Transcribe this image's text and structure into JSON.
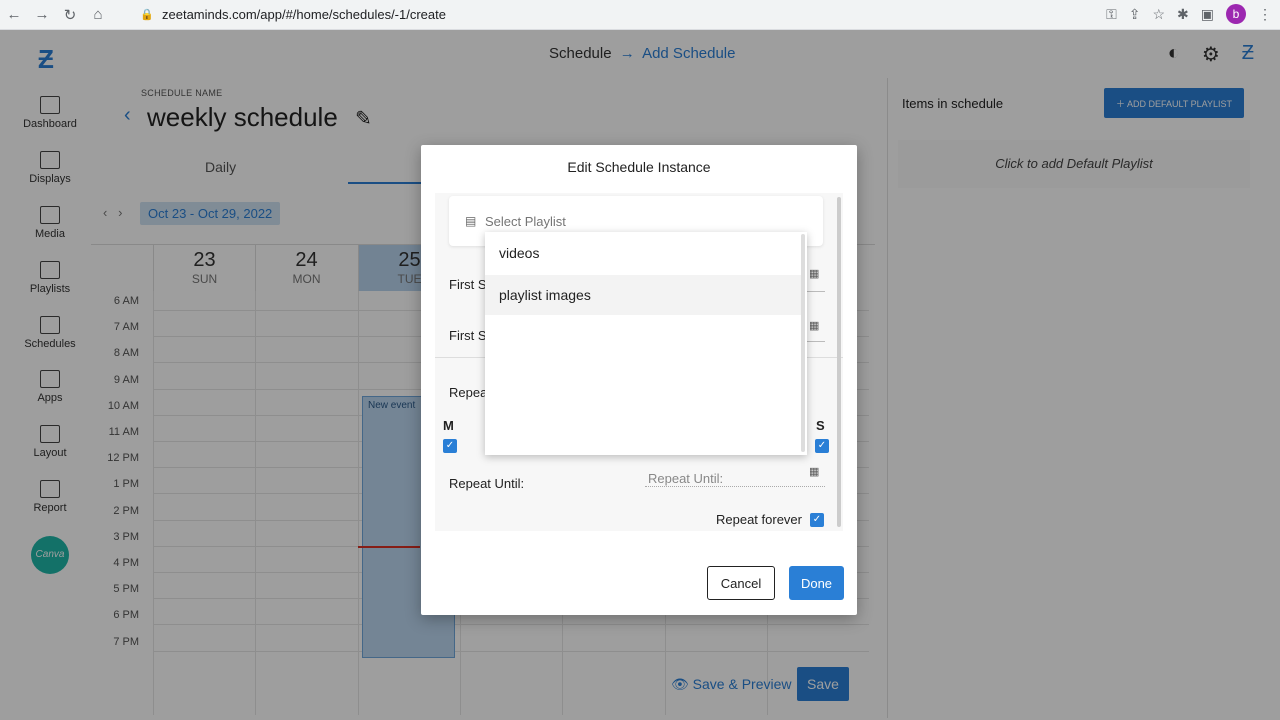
{
  "browser": {
    "url": "zeetaminds.com/app/#/home/schedules/-1/create",
    "avatar_letter": "b"
  },
  "header": {
    "crumb_parent": "Schedule",
    "crumb_current": "Add Schedule"
  },
  "sidebar": {
    "items": [
      {
        "label": "Dashboard",
        "icon": "dashboard-icon"
      },
      {
        "label": "Displays",
        "icon": "monitor-icon"
      },
      {
        "label": "Media",
        "icon": "image-icon"
      },
      {
        "label": "Playlists",
        "icon": "playlist-icon"
      },
      {
        "label": "Schedules",
        "icon": "calendar-icon"
      },
      {
        "label": "Apps",
        "icon": "apps-icon"
      },
      {
        "label": "Layout",
        "icon": "layout-icon"
      },
      {
        "label": "Report",
        "icon": "chart-icon"
      }
    ],
    "canva_label": "Canva"
  },
  "main": {
    "schedule_label": "SCHEDULE NAME",
    "schedule_name": "weekly schedule",
    "tab_daily": "Daily",
    "range": "Oct 23 - Oct 29, 2022",
    "days": [
      {
        "num": "23",
        "day": "SUN"
      },
      {
        "num": "24",
        "day": "MON"
      },
      {
        "num": "25",
        "day": "TUE"
      }
    ],
    "hours": [
      "6 AM",
      "7 AM",
      "8 AM",
      "9 AM",
      "10 AM",
      "11 AM",
      "12 PM",
      "1 PM",
      "2 PM",
      "3 PM",
      "4 PM",
      "5 PM",
      "6 PM",
      "7 PM"
    ],
    "event_label": "New event",
    "save_preview": "Save & Preview",
    "save": "Save"
  },
  "right_panel": {
    "title": "Items in schedule",
    "add_button": "ADD DEFAULT PLAYLIST",
    "hint": "Click to add Default Playlist"
  },
  "dialog": {
    "title": "Edit Schedule Instance",
    "select_placeholder": "Select Playlist",
    "first_start_label": "First S",
    "first_end_label": "First S",
    "repeat_label": "Repea",
    "day_m": "M",
    "day_s": "S",
    "repeat_until_label": "Repeat Until:",
    "repeat_until_placeholder": "Repeat Until:",
    "repeat_forever": "Repeat forever",
    "cancel": "Cancel",
    "done": "Done"
  },
  "dropdown": {
    "options": [
      "videos",
      "playlist images"
    ]
  }
}
